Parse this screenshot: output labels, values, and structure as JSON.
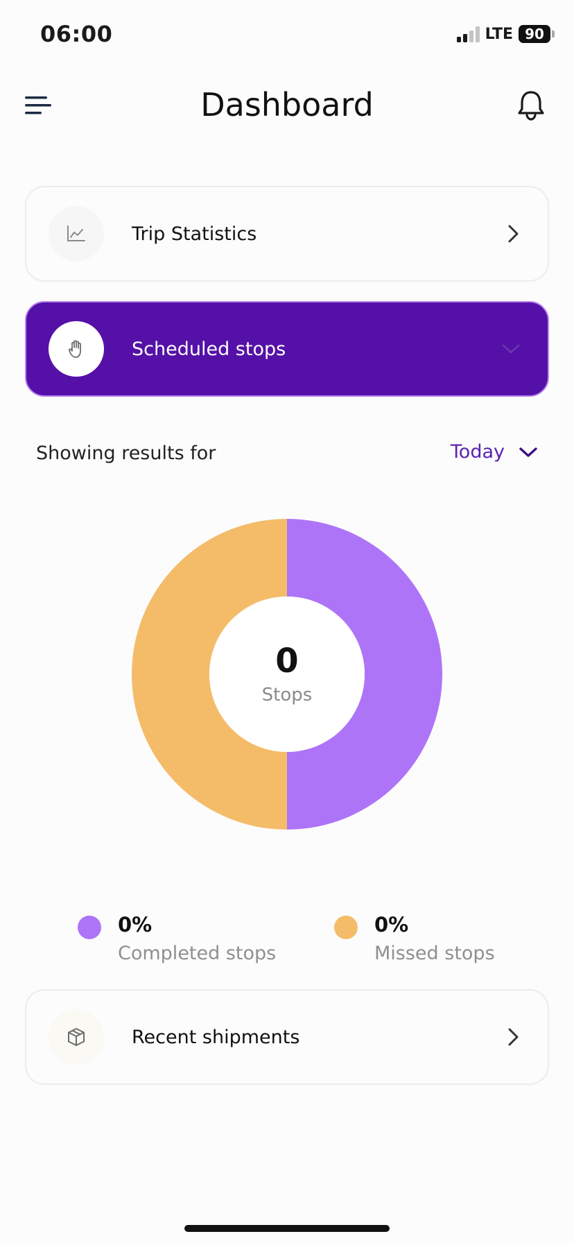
{
  "status_bar": {
    "time": "06:00",
    "network": "LTE",
    "battery": "90"
  },
  "header": {
    "title": "Dashboard"
  },
  "cards": {
    "trip_statistics": {
      "label": "Trip Statistics"
    },
    "scheduled_stops": {
      "label": "Scheduled stops"
    },
    "recent_shipments": {
      "label": "Recent shipments"
    }
  },
  "filter": {
    "label": "Showing results for",
    "value": "Today"
  },
  "chart_data": {
    "type": "pie",
    "categories": [
      "Completed stops",
      "Missed stops"
    ],
    "values": [
      50,
      50
    ],
    "colors": [
      "#ae74f8",
      "#f4bc69"
    ],
    "center_value": "0",
    "center_label": "Stops"
  },
  "legend": [
    {
      "percent": "0%",
      "label": "Completed stops",
      "color": "#ae74f8"
    },
    {
      "percent": "0%",
      "label": "Missed stops",
      "color": "#f4bc69"
    }
  ],
  "colors": {
    "accent": "#5510a8",
    "accent_text": "#5a23b0"
  },
  "icons": {
    "menu": "menu-icon",
    "bell": "bell-icon",
    "trip": "line-chart-icon",
    "stops": "hand-stop-icon",
    "shipments": "package-icon"
  }
}
